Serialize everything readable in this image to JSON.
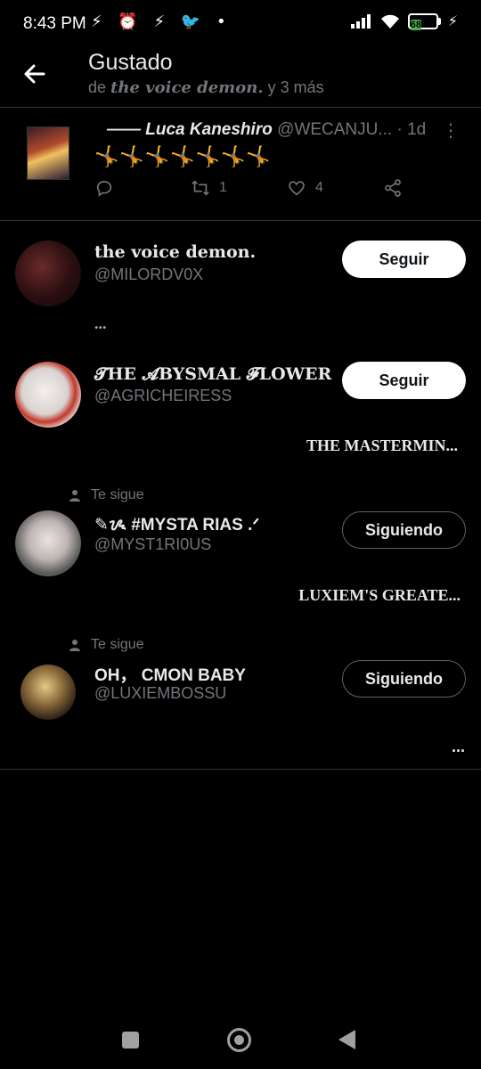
{
  "status_bar": {
    "time": "8:43 PM",
    "left_icons": "⚡ ⏰ ⚡ 🐦 •",
    "battery": "68",
    "signal_icon": "signal-icon",
    "wifi_icon": "wifi-icon",
    "charging_icon": "charging-icon"
  },
  "header": {
    "title": "Gustado",
    "subtitle_prefix": "de",
    "subtitle_name": "the voice demon.",
    "subtitle_suffix": "y 3 más"
  },
  "tweet": {
    "name": "—— Luca Kaneshiro",
    "handle": "@WECANJU...",
    "time": "· 1d",
    "text": "🤸🤸🤸🤸🤸🤸🤸",
    "replies": "",
    "retweets": "1",
    "likes": "4"
  },
  "users": [
    {
      "name": "the voice demon.",
      "handle": "@MILORDV0X",
      "button": "Seguir",
      "bio": "...",
      "follows_you": false
    },
    {
      "name": "𝓣HE 𝓐BYSMAL 𝓕LOWER",
      "handle": "@AGRICHEIRESS",
      "button": "Seguir",
      "bio": "THE MASTERMIN...",
      "follows_you": false
    },
    {
      "name": "✎ᝰ #MYSTA RIAS .ᐟ",
      "handle": "@MYST1RI0US",
      "button": "Siguiendo",
      "bio": "LUXIEM'S GREATE...",
      "follows_you": true,
      "follows_label": "Te sigue"
    },
    {
      "name": "OH， CMON BABY",
      "handle": "@LUXIEMBOSSU",
      "button": "Siguiendo",
      "bio": "...",
      "follows_you": true,
      "follows_label": "Te sigue"
    }
  ],
  "colors": {
    "background": "#000000",
    "text": "#e7e9ea",
    "muted": "#71767b",
    "divider": "#2f3336",
    "battery": "#4caf50"
  }
}
